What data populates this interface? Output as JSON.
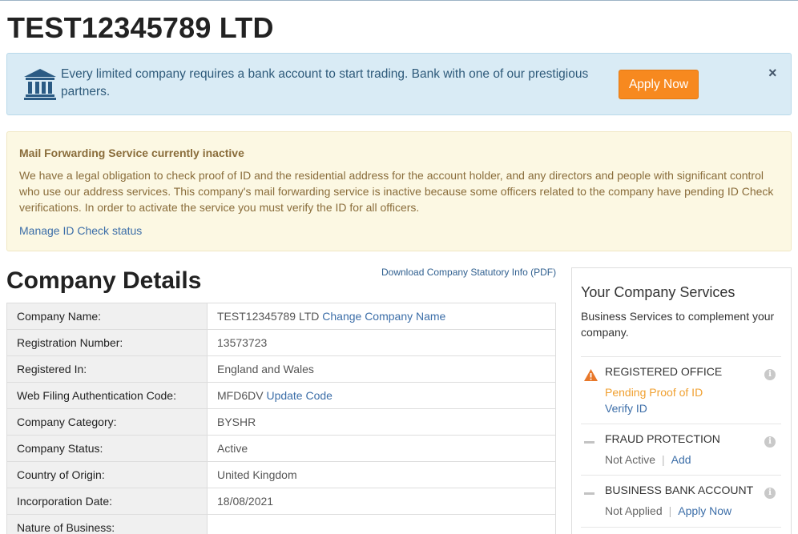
{
  "company_title": "TEST12345789 LTD",
  "bank_alert": {
    "icon": "bank-icon",
    "text": "Every limited company requires a bank account to start trading. Bank with one of our prestigious partners.",
    "apply_label": "Apply Now",
    "close_label": "×",
    "colors": {
      "background": "#d9ebf5",
      "button": "#f7891f"
    }
  },
  "mail_alert": {
    "title": "Mail Forwarding Service currently inactive",
    "body": "We have a legal obligation to check proof of ID and the residential address for the account holder, and any directors and people with significant control who use our address services. This company's mail forwarding service is inactive because some officers related to the company have pending ID Check verifications. In order to activate the service you must verify the ID for all officers.",
    "link": "Manage ID Check status",
    "colors": {
      "background": "#fcf8e3",
      "text": "#8a6d3b"
    }
  },
  "details": {
    "title": "Company Details",
    "download_link": "Download Company Statutory Info (PDF)",
    "rows": [
      {
        "label": "Company Name:",
        "value": "TEST12345789 LTD",
        "link": "Change Company Name"
      },
      {
        "label": "Registration Number:",
        "value": "13573723"
      },
      {
        "label": "Registered In:",
        "value": "England and Wales"
      },
      {
        "label": "Web Filing Authentication Code:",
        "value": "MFD6DV",
        "link": "Update Code"
      },
      {
        "label": "Company Category:",
        "value": "BYSHR"
      },
      {
        "label": "Company Status:",
        "value": "Active"
      },
      {
        "label": "Country of Origin:",
        "value": "United Kingdom"
      },
      {
        "label": "Incorporation Date:",
        "value": "18/08/2021"
      },
      {
        "label": "Nature of Business:",
        "value": ""
      }
    ]
  },
  "services": {
    "heading": "Your Company Services",
    "intro": "Business Services to complement your company.",
    "items": [
      {
        "icon": "warning-icon",
        "name": "REGISTERED OFFICE",
        "status": "Pending Proof of ID",
        "link": "Verify ID"
      },
      {
        "icon": "dash-icon",
        "name": "FRAUD PROTECTION",
        "status": "Not Active",
        "separator": "|",
        "link": "Add"
      },
      {
        "icon": "dash-icon",
        "name": "BUSINESS BANK ACCOUNT",
        "status": "Not Applied",
        "separator": "|",
        "link": "Apply Now"
      }
    ],
    "info_glyph": "i",
    "colors": {
      "warning": "#e8782a",
      "pending": "#f0a030",
      "link": "#3c6ea8"
    }
  }
}
